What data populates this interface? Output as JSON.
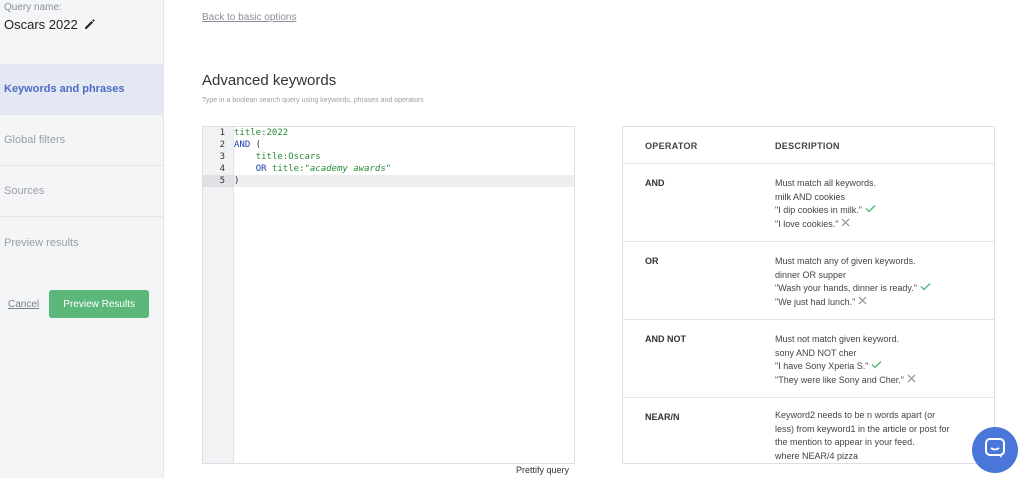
{
  "sidebar": {
    "query_label": "Query name:",
    "query_name": "Oscars 2022",
    "nav": [
      {
        "label": "Keywords and phrases",
        "active": true
      },
      {
        "label": "Global filters",
        "active": false
      },
      {
        "label": "Sources",
        "active": false
      },
      {
        "label": "Preview results",
        "active": false
      }
    ],
    "cancel_label": "Cancel",
    "preview_label": "Preview Results"
  },
  "main": {
    "back_link": "Back to basic options",
    "title": "Advanced keywords",
    "subtitle": "Type in a boolean search query using keywords, phrases and operators",
    "prettify_label": "Prettify query"
  },
  "editor": {
    "line_numbers": [
      "1",
      "2",
      "3",
      "4",
      "5"
    ],
    "current_line": 5,
    "tokens": {
      "l1_field": "title:2022",
      "l2_op": "AND",
      "l2_paren": " (",
      "l3_field": "title:Oscars",
      "l4_op": "OR",
      "l4_field": " title:",
      "l4_str": "\"academy awards\"",
      "l5_paren": ")"
    }
  },
  "operators": {
    "header_operator": "OPERATOR",
    "header_description": "DESCRIPTION",
    "rows": [
      {
        "name": "AND",
        "desc": "Must match all keywords.",
        "example": "milk AND cookies",
        "good": "\"I dip cookies in milk.\"",
        "bad": "\"I love cookies.\""
      },
      {
        "name": "OR",
        "desc": "Must match any of given keywords.",
        "example": "dinner OR supper",
        "good": "\"Wash your hands, dinner is ready.\"",
        "bad": "\"We just had lunch.\""
      },
      {
        "name": "AND NOT",
        "desc": "Must not match given keyword.",
        "example": "sony AND NOT cher",
        "good": "\"I have Sony Xperia S.\"",
        "bad": "\"They were like Sony and Cher.\""
      },
      {
        "name": "NEAR/N",
        "desc_lines": [
          "Keyword2 needs to be n words apart (or",
          "less) from keyword1 in the article or post for",
          "the mention to appear in your feed.",
          "where NEAR/4 pizza"
        ]
      }
    ]
  },
  "colors": {
    "accent": "#4b6cc8",
    "primary_button": "#5cb87a",
    "check": "#5cb87a",
    "cross": "#8a8f98",
    "chat": "#4a76d9"
  },
  "icons": {
    "edit": "pencil-icon",
    "match": "check-icon",
    "no_match": "cross-icon",
    "chat": "chat-icon"
  }
}
